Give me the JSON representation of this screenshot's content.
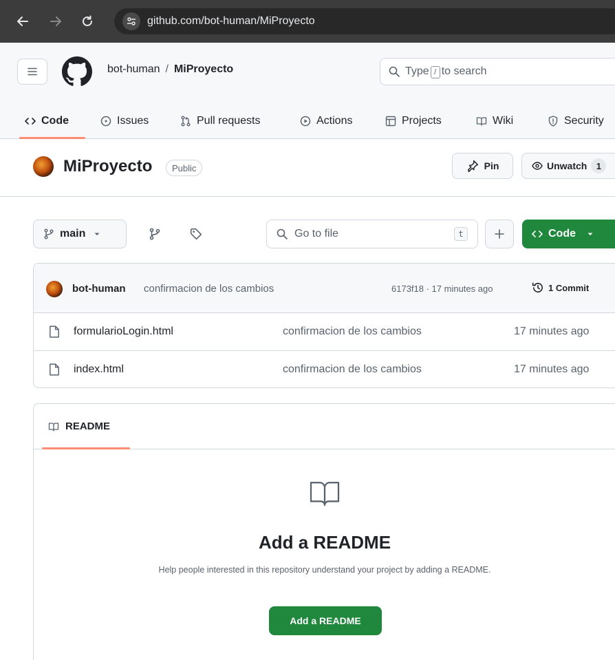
{
  "browser": {
    "url": "github.com/bot-human/MiProyecto"
  },
  "header": {
    "owner": "bot-human",
    "separator": "/",
    "repo": "MiProyecto",
    "search_prefix": "Type",
    "search_key": "/",
    "search_suffix": "to search"
  },
  "repo_nav": {
    "tabs": [
      {
        "label": "Code",
        "icon": "code-icon",
        "active": true
      },
      {
        "label": "Issues",
        "icon": "issue-icon"
      },
      {
        "label": "Pull requests",
        "icon": "pull-request-icon"
      },
      {
        "label": "Actions",
        "icon": "play-icon"
      },
      {
        "label": "Projects",
        "icon": "table-icon"
      },
      {
        "label": "Wiki",
        "icon": "book-icon"
      },
      {
        "label": "Security",
        "icon": "shield-icon"
      }
    ]
  },
  "repo": {
    "name": "MiProyecto",
    "visibility": "Public",
    "pin_label": "Pin",
    "unwatch_label": "Unwatch",
    "watch_count": "1"
  },
  "toolbar": {
    "branch": "main",
    "goto_placeholder": "Go to file",
    "goto_key": "t",
    "code_label": "Code"
  },
  "latest_commit": {
    "author": "bot-human",
    "message": "confirmacion de los cambios",
    "meta": "6173f18 · 17 minutes ago",
    "commit_count": "1 Commit"
  },
  "files": [
    {
      "name": "formularioLogin.html",
      "commit": "confirmacion de los cambios",
      "time": "17 minutes ago"
    },
    {
      "name": "index.html",
      "commit": "confirmacion de los cambios",
      "time": "17 minutes ago"
    }
  ],
  "readme": {
    "tab_label": "README",
    "heading": "Add a README",
    "help_text": "Help people interested in this repository understand your project by adding a README.",
    "button_label": "Add a README"
  },
  "colors": {
    "accent_green": "#1f883d",
    "tab_underline": "#fd8c73",
    "browser_chrome": "#3c3c3c"
  }
}
